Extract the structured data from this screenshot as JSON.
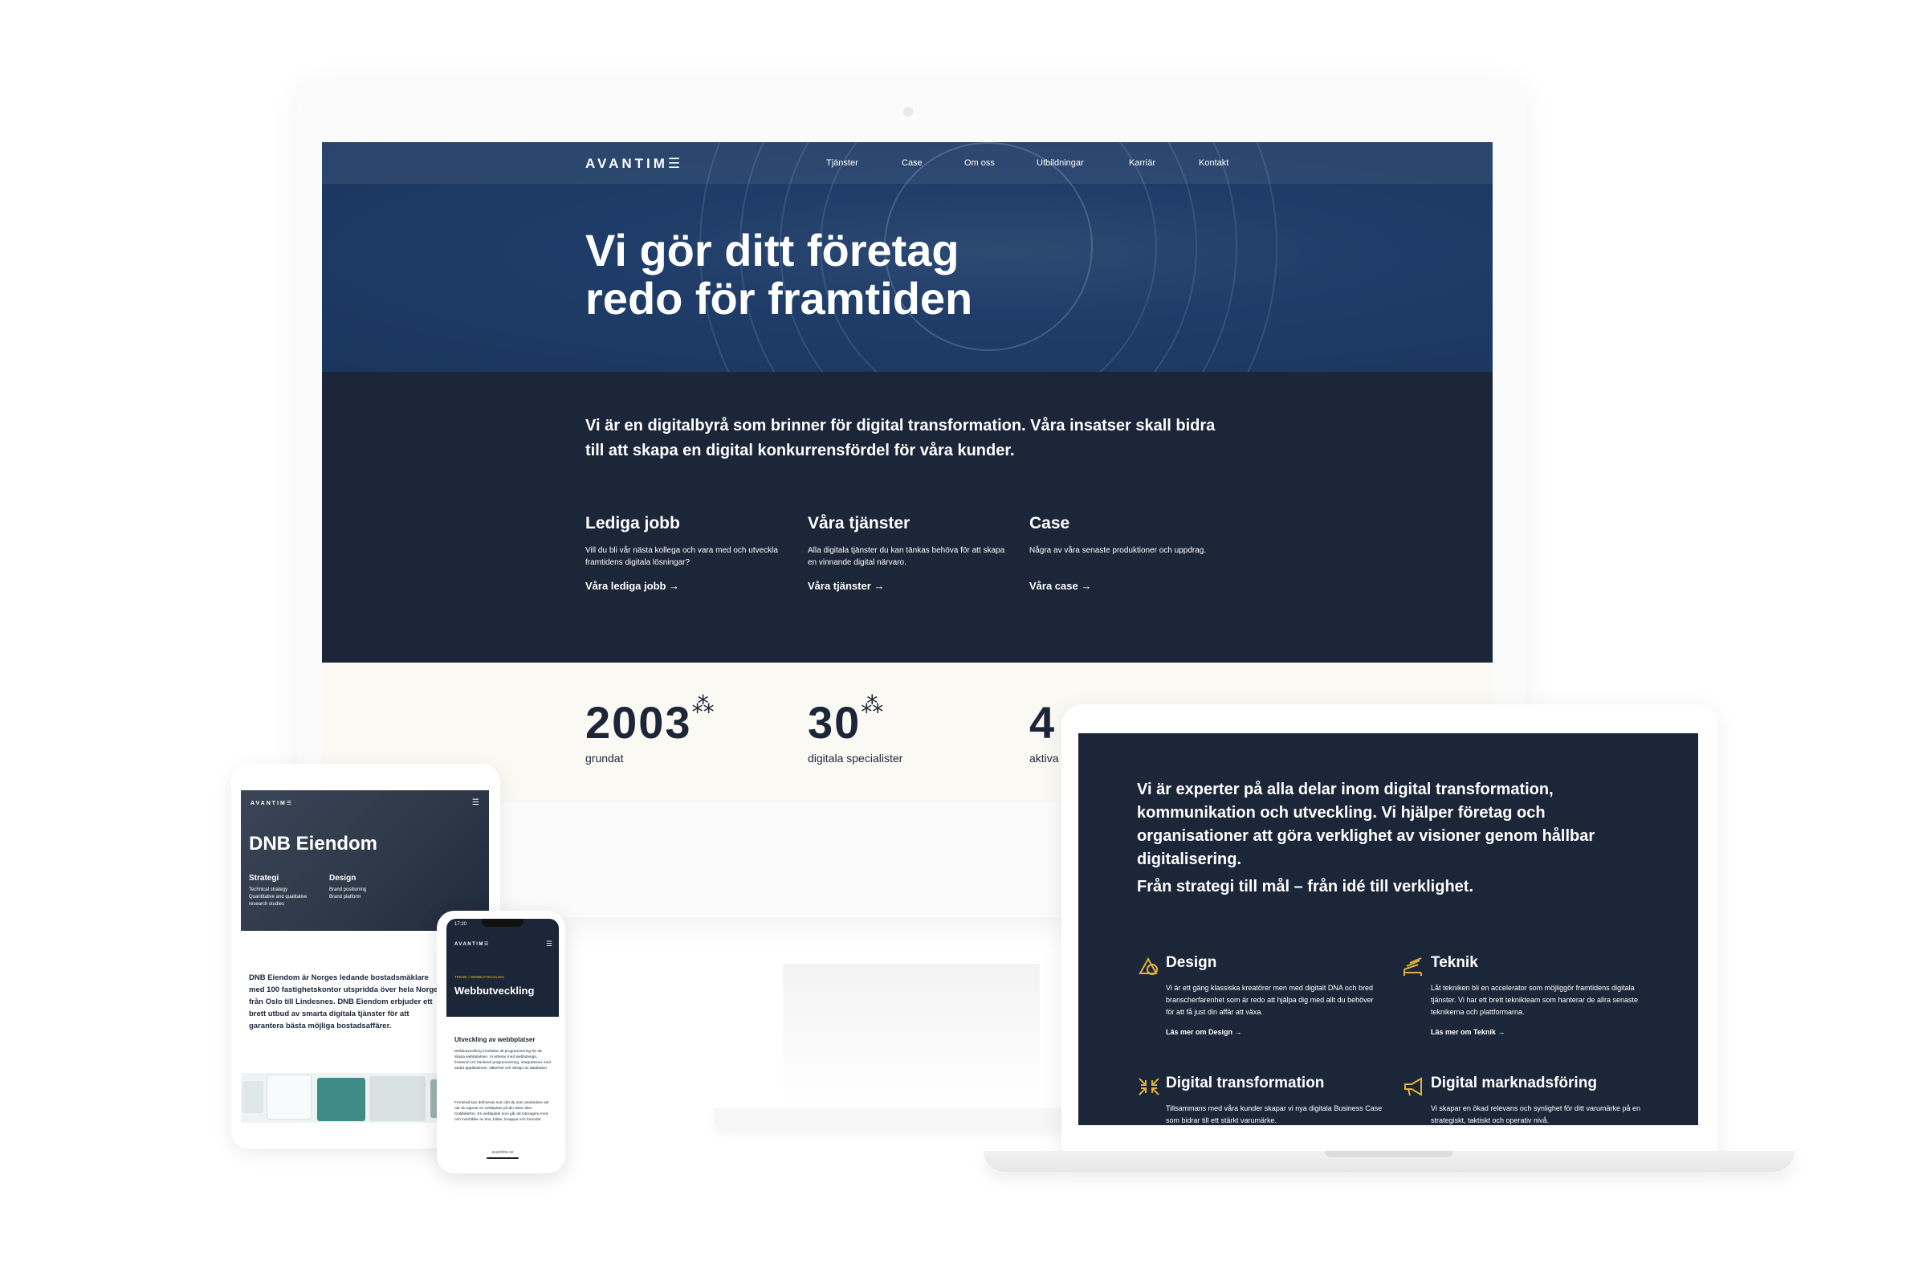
{
  "monitor": {
    "logo": "AVANTIM☰",
    "nav": [
      "Tjänster",
      "Case",
      "Om oss",
      "Utbildningar",
      "Karriär",
      "Kontakt"
    ],
    "hero_title_line1": "Vi gör ditt företag",
    "hero_title_line2": "redo för framtiden",
    "intro": "Vi är en digitalbyrå som brinner för digital transformation. Våra insatser skall bidra till att skapa en digital konkurrensfördel för våra kunder.",
    "columns": [
      {
        "title": "Lediga jobb",
        "text": "Vill du bli vår nästa kollega och vara med och utveckla framtidens digitala lösningar?",
        "link": "Våra lediga jobb →"
      },
      {
        "title": "Våra tjänster",
        "text": "Alla digitala tjänster du kan tänkas behöva för att skapa en vinnande digital närvaro.",
        "link": "Våra tjänster →"
      },
      {
        "title": "Case",
        "text": "Några av våra senaste produktioner och uppdrag.",
        "link": "Våra case →"
      }
    ],
    "stats": [
      {
        "number": "2003",
        "star": "⁂",
        "label": "grundat"
      },
      {
        "number": "30",
        "star": "⁂",
        "label": "digitala specialister"
      },
      {
        "number": "4",
        "star": "",
        "label": "aktiva"
      }
    ]
  },
  "laptop": {
    "intro": "Vi är experter på alla delar inom digital transformation, kommunikation och utveckling. Vi hjälper företag och organisationer att göra verklighet av visioner genom hållbar digitalisering.",
    "tagline": "Från strategi till mål – från idé till verklighet.",
    "services": [
      {
        "title": "Design",
        "icon": "shapes-icon",
        "text": "Vi är ett gäng klassiska kreatörer men med digitalt DNA och bred branscherfarenhet som är redo att hjälpa dig med allt du behöver för att få just din affär att växa.",
        "link": "Läs mer om Design →"
      },
      {
        "title": "Teknik",
        "icon": "stack-icon",
        "text": "Låt tekniken bli en accelerator som möjliggör framtidens digitala tjänster. Vi har ett brett teknikteam som hanterar de allra senaste teknikerna och plattformarna.",
        "link": "Läs mer om Teknik →"
      },
      {
        "title": "Digital transformation",
        "icon": "arrows-in-icon",
        "text": "Tillsammans med våra kunder skapar vi nya digitala Business Case som bidrar till ett stärkt varumärke.",
        "link": ""
      },
      {
        "title": "Digital marknadsföring",
        "icon": "megaphone-icon",
        "text": "Vi skapar en ökad relevans och synlighet för ditt varumärke på en strategiskt, taktiskt och operativ nivå.",
        "link": ""
      }
    ],
    "accent": "#e2b33a"
  },
  "tablet": {
    "logo": "AVANTIM☰",
    "title": "DNB Eiendom",
    "sub": [
      {
        "head": "Strategi",
        "desc": "Technical strategy\nQuantitative and qualitative\nresearch studies"
      },
      {
        "head": "Design",
        "desc": "Brand positioning\nBrand platform"
      }
    ],
    "body": "DNB Eiendom är Norges ledande bostadsmäklare med 100 fastighetskontor utspridda över hela Norge från Oslo till Lindesnes. DNB Eiendom erbjuder ett brett utbud av smarta digitala tjänster för att garantera bästa möjliga bostadsaffärer."
  },
  "phone": {
    "time": "17:20",
    "logo": "AVANTIM☰",
    "crumb": "TEKNIK  /  WEBBUTVECKLING",
    "title": "Webbutveckling",
    "heading": "Utveckling av webbplatser",
    "para1": "Webbutveckling innefattar all programmering för att skapa webbplatsen. Vi arbetar med webbdesign, frontend och backend programmering, integrationer med andra applikationer, säkerhet och design av databaser.",
    "para2": "Frontend kan definieras som det du som användare ser när du öppnar en webbplats på din dator eller mobiltelefon. En webbplats som går att interagera med och innehåller av text, bilder, knappar och formulär.",
    "url": "avantime.se"
  },
  "colors": {
    "navy": "#1c2639",
    "hero_blue": "#1f3d68",
    "cream": "#fbf9f3",
    "gold": "#e2b33a"
  }
}
